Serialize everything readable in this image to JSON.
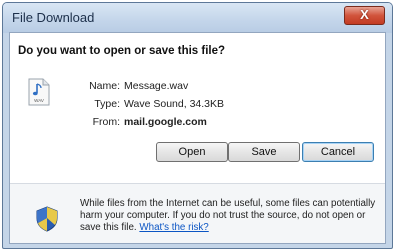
{
  "window": {
    "title": "File Download",
    "close_glyph": "X"
  },
  "dialog": {
    "question": "Do you want to open or save this file?",
    "file_icon_label": "WAV",
    "fields": [
      {
        "label": "Name:",
        "value": "Message.wav"
      },
      {
        "label": "Type:",
        "value": "Wave Sound, 34.3KB"
      },
      {
        "label": "From:",
        "value": "mail.google.com"
      }
    ],
    "buttons": {
      "open": "Open",
      "save": "Save",
      "cancel": "Cancel"
    },
    "warning": {
      "text": "While files from the Internet can be useful, some files can potentially harm your computer. If you do not trust the source, do not open or save this file.",
      "link": "What's the risk?"
    }
  },
  "icons": {
    "file": "wav-file-icon",
    "security": "shield-icon",
    "close": "close-icon"
  },
  "colors": {
    "title_bar": "#c3d5ea",
    "close_button": "#d1543c",
    "link": "#0b55c4",
    "shield_blue": "#2a5db0"
  }
}
